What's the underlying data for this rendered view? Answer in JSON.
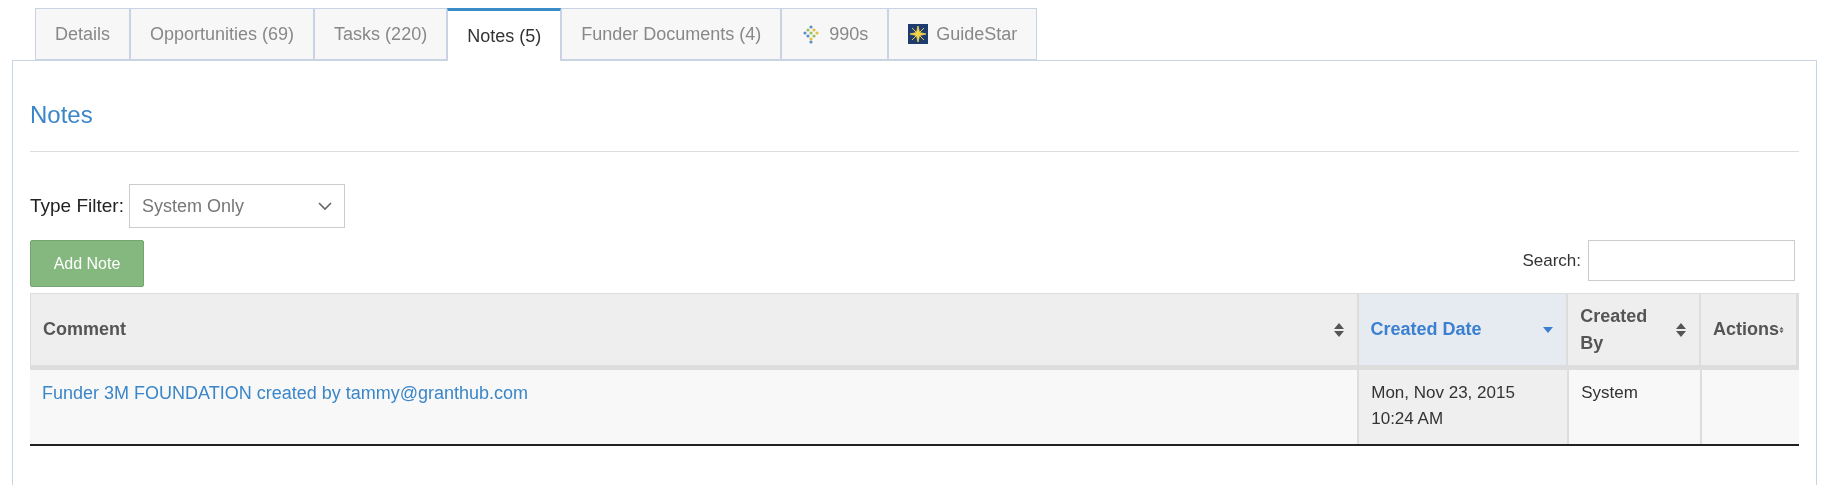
{
  "tabs": [
    {
      "label": "Details",
      "selected": false,
      "kind": "text"
    },
    {
      "label": "Opportunities (69)",
      "selected": false,
      "kind": "text"
    },
    {
      "label": "Tasks (220)",
      "selected": false,
      "kind": "text"
    },
    {
      "label": "Notes (5)",
      "selected": true,
      "kind": "text"
    },
    {
      "label": "Funder Documents (4)",
      "selected": false,
      "kind": "text"
    },
    {
      "label": "990s",
      "selected": false,
      "kind": "dots"
    },
    {
      "label": "GuideStar",
      "selected": false,
      "kind": "star"
    }
  ],
  "section_title": "Notes",
  "type_filter": {
    "label": "Type Filter:",
    "value": "System Only"
  },
  "add_button": "Add Note",
  "search": {
    "label": "Search:"
  },
  "table": {
    "columns": [
      {
        "label": "Comment",
        "sorted": false
      },
      {
        "label": "Created Date",
        "sorted": true
      },
      {
        "label": "Created By",
        "sorted": false
      },
      {
        "label": "Actions",
        "sorted": false
      }
    ],
    "rows": [
      {
        "comment": "Funder 3M FOUNDATION created by tammy@granthub.com",
        "created_date": [
          "Mon, Nov 23, 2015",
          "10:24 AM"
        ],
        "created_by": "System"
      }
    ]
  }
}
